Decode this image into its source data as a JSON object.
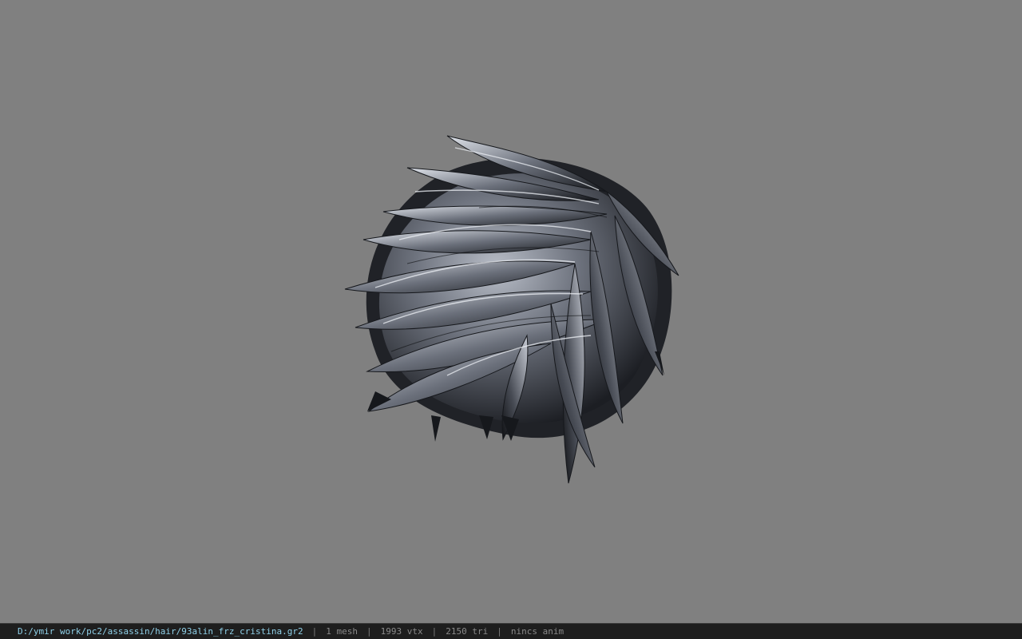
{
  "viewport": {
    "background_color": "#808080",
    "model": "hair mesh preview"
  },
  "status_bar": {
    "file_path": "D:/ymir work/pc2/assassin/hair/93alin_frz_cristina.gr2",
    "separator": "|",
    "mesh_count": "1 mesh",
    "vertex_count": "1993 vtx",
    "triangle_count": "2150 tri",
    "animation": "nincs anim",
    "path_color": "#8fd0e8",
    "text_color": "#8a8a8a"
  }
}
